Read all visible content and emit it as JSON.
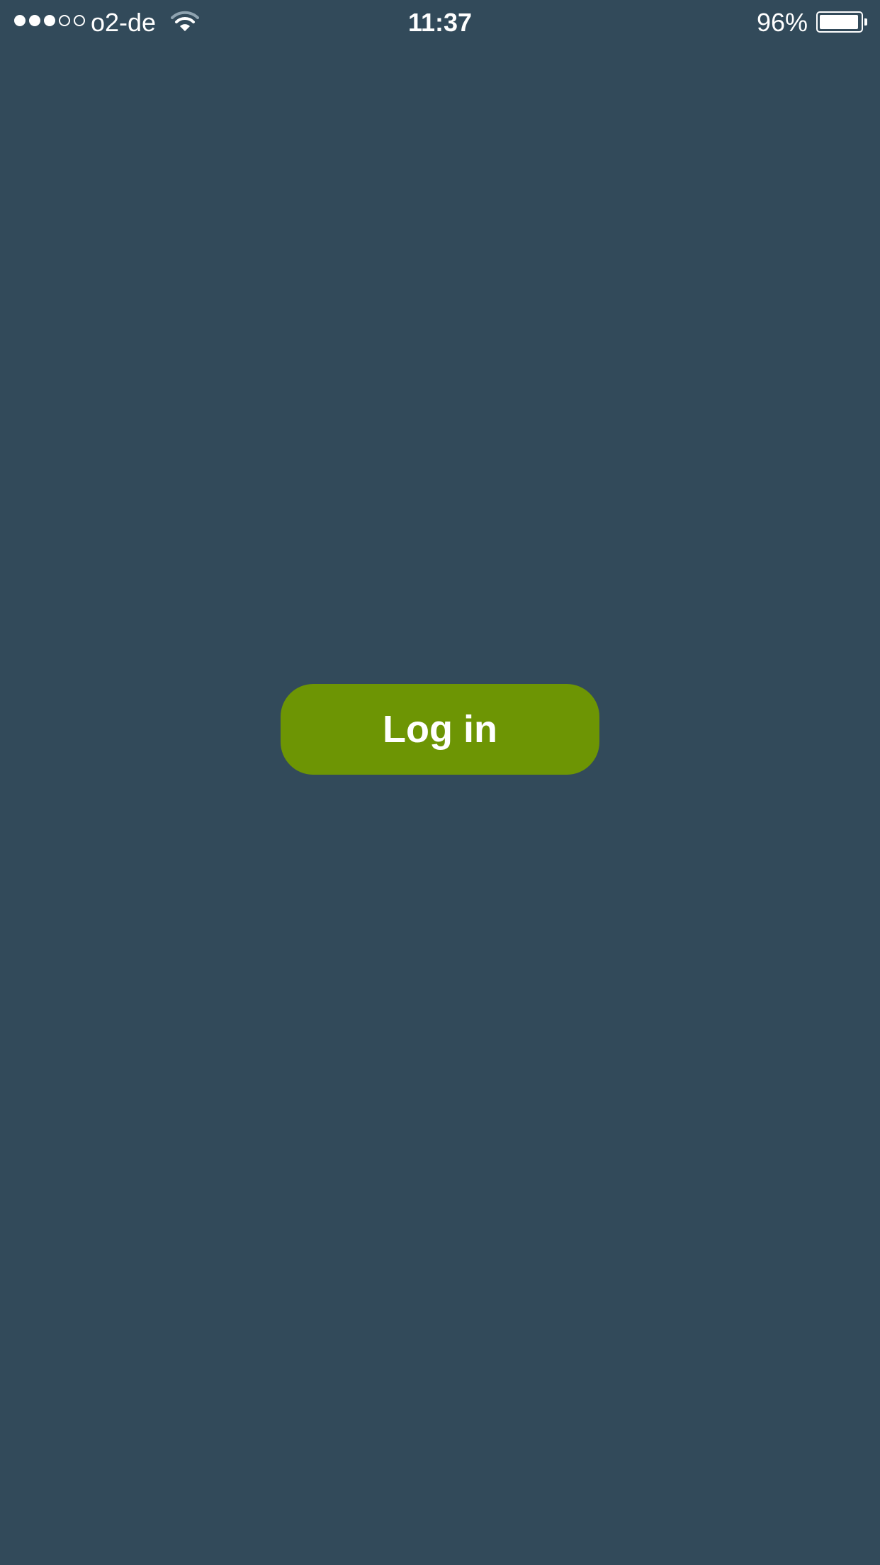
{
  "status_bar": {
    "signal_strength": {
      "filled": 3,
      "total": 5
    },
    "carrier": "o2-de",
    "wifi_icon": "wifi-icon",
    "time": "11:37",
    "battery_percent_text": "96%",
    "battery_level": 0.96
  },
  "main": {
    "login_button_label": "Log in"
  },
  "colors": {
    "background": "#324a5a",
    "button": "#6d9504",
    "text": "#ffffff"
  }
}
